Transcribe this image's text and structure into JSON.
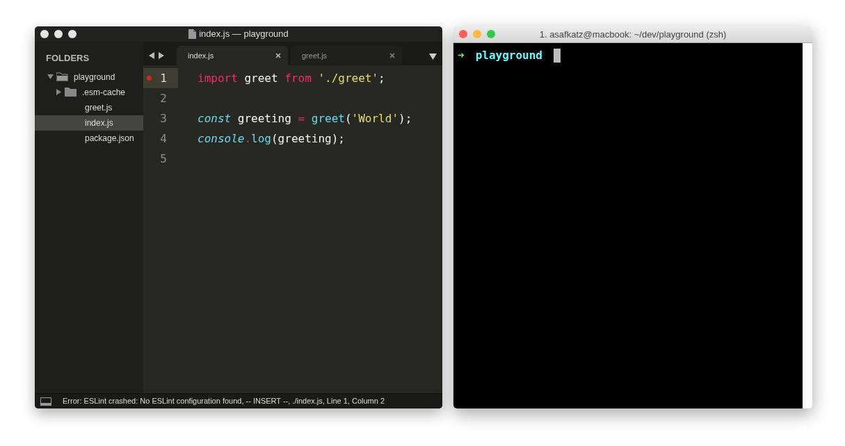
{
  "editor": {
    "title": "index.js — playground",
    "sidebar": {
      "heading": "FOLDERS",
      "tree": [
        {
          "label": "playground",
          "kind": "folder",
          "expanded": true,
          "selected": false,
          "children": [
            {
              "label": ".esm-cache",
              "kind": "folder",
              "expanded": false,
              "selected": false
            },
            {
              "label": "greet.js",
              "kind": "file",
              "selected": false
            },
            {
              "label": "index.js",
              "kind": "file",
              "selected": true
            },
            {
              "label": "package.json",
              "kind": "file",
              "selected": false
            }
          ]
        }
      ]
    },
    "tabs": [
      {
        "label": "index.js",
        "selected": true
      },
      {
        "label": "greet.js",
        "selected": false
      }
    ],
    "lines": [
      {
        "number": "1",
        "breakpoint": true,
        "current": true,
        "tokens": [
          {
            "text": "import",
            "kind": "keyword"
          },
          {
            "text": " greet ",
            "kind": "plain"
          },
          {
            "text": "from ",
            "kind": "keyword"
          },
          {
            "text": "'./greet'",
            "kind": "string"
          },
          {
            "text": ";",
            "kind": "plain"
          }
        ]
      },
      {
        "number": "2",
        "breakpoint": false,
        "current": false
      },
      {
        "number": "3",
        "breakpoint": false,
        "current": false,
        "tokens": [
          {
            "text": "const",
            "kind": "storage"
          },
          {
            "text": " greeting ",
            "kind": "plain"
          },
          {
            "text": "= ",
            "kind": "keyword"
          },
          {
            "text": "greet",
            "kind": "function"
          },
          {
            "text": "(",
            "kind": "plain"
          },
          {
            "text": "'World'",
            "kind": "string"
          },
          {
            "text": ");",
            "kind": "plain"
          }
        ]
      },
      {
        "number": "4",
        "breakpoint": false,
        "current": false,
        "tokens": [
          {
            "text": "console",
            "kind": "storage"
          },
          {
            "text": ".",
            "kind": "keyword"
          },
          {
            "text": "log",
            "kind": "function"
          },
          {
            "text": "(greeting);",
            "kind": "plain"
          }
        ]
      },
      {
        "number": "5",
        "breakpoint": false,
        "current": false
      }
    ],
    "status": "Error: ESLint crashed: No ESLint configuration found, -- INSERT --, ./index.js, Line 1, Column 2"
  },
  "terminal": {
    "title": "1. asafkatz@macbook: ~/dev/playground (zsh)",
    "prompt": "➜",
    "directory": "playground"
  }
}
